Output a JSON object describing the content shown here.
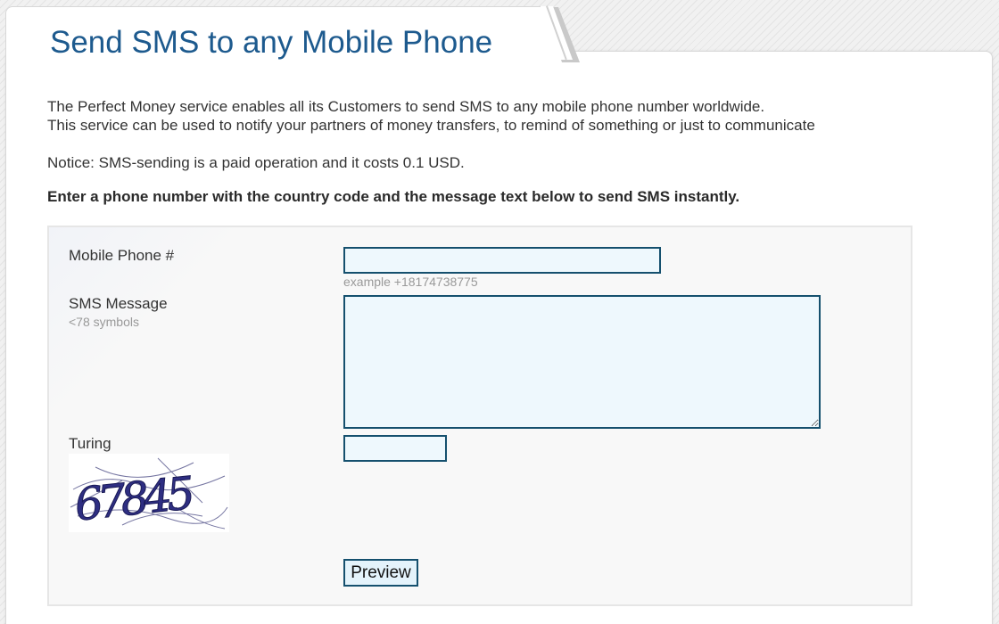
{
  "page": {
    "title": "Send SMS to any Mobile Phone",
    "intro_line1": "The Perfect Money service enables all its Customers to send SMS to any mobile phone number worldwide.",
    "intro_line2": "This service can be used to notify your partners of money transfers, to remind of something or just to communicate",
    "notice": "Notice: SMS-sending is a paid operation and it costs 0.1 USD.",
    "instructions": "Enter a phone number with the country code and the message text below to send SMS instantly."
  },
  "form": {
    "phone_label": "Mobile Phone #",
    "phone_value": "",
    "phone_hint": "example +18174738775",
    "message_label": "SMS Message",
    "message_sublabel": "<78 symbols",
    "message_value": "",
    "turing_label": "Turing",
    "turing_value": "",
    "captcha_text": "67845",
    "preview_label": "Preview"
  },
  "colors": {
    "title": "#1d5a8e",
    "field_border": "#15506e",
    "field_background": "#eef8fd"
  }
}
